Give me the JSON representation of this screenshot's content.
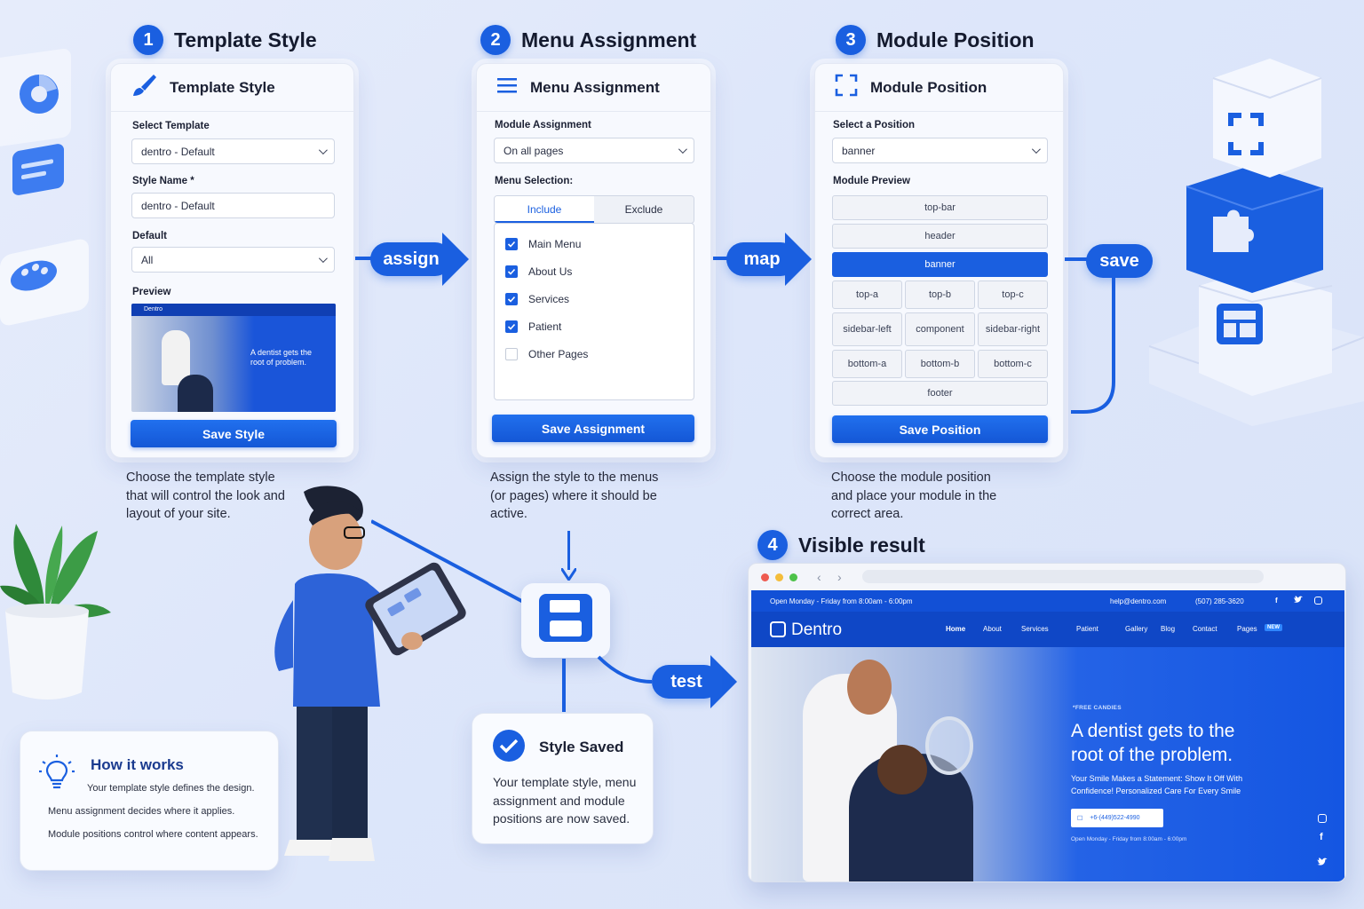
{
  "steps": [
    {
      "num": "1",
      "title": "Template Style"
    },
    {
      "num": "2",
      "title": "Menu Assignment"
    },
    {
      "num": "3",
      "title": "Module Position"
    },
    {
      "num": "4",
      "title": "Visible result"
    }
  ],
  "panel1": {
    "header": "Template Style",
    "select_template_label": "Select Template",
    "select_template_value": "dentro - Default",
    "style_name_label": "Style Name *",
    "style_name_value": "dentro - Default",
    "default_label": "Default",
    "default_value": "All",
    "preview_label": "Preview",
    "save_button": "Save Style",
    "description": "Choose the template style that will control the look and layout of your site."
  },
  "panel2": {
    "header": "Menu Assignment",
    "module_assignment_label": "Module Assignment",
    "module_assignment_value": "On all pages",
    "menu_selection_label": "Menu Selection:",
    "tabs": [
      "Include",
      "Exclude"
    ],
    "items": [
      {
        "label": "Main Menu",
        "checked": true
      },
      {
        "label": "About Us",
        "checked": true
      },
      {
        "label": "Services",
        "checked": true
      },
      {
        "label": "Patient",
        "checked": true
      },
      {
        "label": "Other Pages",
        "checked": false
      }
    ],
    "save_button": "Save Assignment",
    "description": "Assign the style to the menus (or pages) where it should be active."
  },
  "panel3": {
    "header": "Module Position",
    "select_position_label": "Select a Position",
    "select_position_value": "banner",
    "module_preview_label": "Module Preview",
    "positions": {
      "top_bar": "top-bar",
      "header": "header",
      "banner": "banner",
      "top_a": "top-a",
      "top_b": "top-b",
      "top_c": "top-c",
      "sidebar_left": "sidebar-left",
      "component": "component",
      "sidebar_right": "sidebar-right",
      "bottom_a": "bottom-a",
      "bottom_b": "bottom-b",
      "bottom_c": "bottom-c",
      "footer": "footer"
    },
    "selected_position": "banner",
    "save_button": "Save Position",
    "description": "Choose the module position and place your module in the correct area."
  },
  "connectors": {
    "assign": "assign",
    "map": "map",
    "save": "save",
    "test": "test"
  },
  "how_it_works": {
    "title": "How it works",
    "lines": [
      "Your template style defines the design.",
      "Menu assignment decides where it applies.",
      "Module positions control where content appears."
    ]
  },
  "style_saved": {
    "title": "Style Saved",
    "text": "Your template style, menu assignment and module positions are now saved."
  },
  "site": {
    "topbar_left": "Open Monday - Friday from 8:00am - 6:00pm",
    "email": "help@dentro.com",
    "phone": "(507) 285-3620",
    "brand": "Dentro",
    "nav": [
      "Home",
      "About",
      "Services",
      "Patient",
      "Gallery",
      "Blog",
      "Contact",
      "Pages"
    ],
    "nav_badge": "NEW",
    "hero_tag": "*FREE CANDIES",
    "hero_title_line1": "A dentist gets to the",
    "hero_title_line2": "root of the problem.",
    "hero_sub_line1": "Your Smile Makes a Statement: Show It Off With",
    "hero_sub_line2": "Confidence! Personalized Care For Every Smile",
    "hero_phone": "+6-(449)522-4990",
    "hero_hours": "Open Monday - Friday from 8:00am - 6:00pm"
  },
  "preview_thumb": {
    "brand": "Dentro",
    "headline": "A dentist gets the root of problem."
  },
  "colors": {
    "accent": "#1a5fe0",
    "background": "#e2e9f9"
  }
}
